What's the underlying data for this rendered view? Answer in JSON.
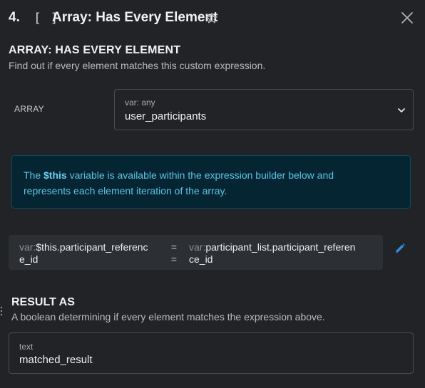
{
  "header": {
    "number": "4.",
    "type_glyph": "[ ]",
    "title": "Array: Has Every Element",
    "star_icon": "star-outline-icon",
    "close_icon": "close-icon"
  },
  "section": {
    "title": "ARRAY: HAS EVERY ELEMENT",
    "description": "Find out if every element matches this custom expression."
  },
  "array_field": {
    "label": "ARRAY",
    "type_label": "var: any",
    "value": "user_participants"
  },
  "info": {
    "prefix": "The ",
    "highlight": "$this",
    "line1_rest": " variable is available within the expression builder below and",
    "line2": "represents each element iteration of the array."
  },
  "expression": {
    "left_prefix": "var:",
    "left_line1": "$this.participant_referenc",
    "left_line2": "e_id",
    "operator": "=",
    "right_prefix": "var:",
    "right_line1": "participant_list.participant_referen",
    "right_line2": "ce_id"
  },
  "result": {
    "title": "RESULT AS",
    "description": "A boolean determining if every element matches the expression above.",
    "type_label": "text",
    "value": "matched_result"
  },
  "colors": {
    "background": "#212327",
    "info_bg": "#062532",
    "info_text": "#5ec3e6",
    "edit_icon": "#2f8fe0"
  }
}
